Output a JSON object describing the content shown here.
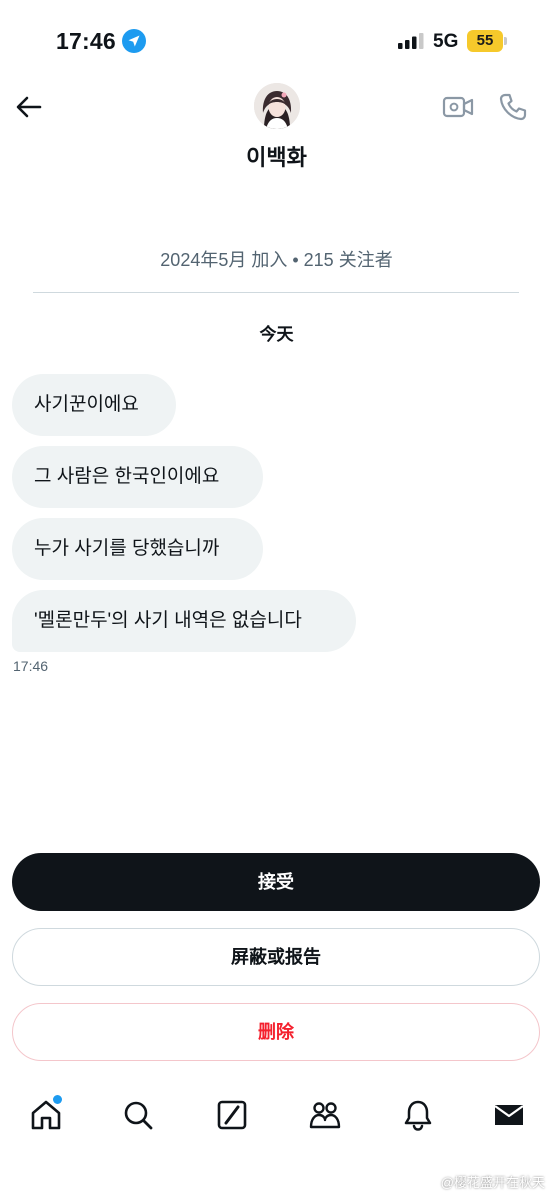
{
  "status_bar": {
    "time": "17:46",
    "network": "5G",
    "battery": "55",
    "icons": [
      "location-arrow-icon",
      "signal-bars-icon",
      "battery-icon"
    ]
  },
  "header": {
    "contact_name": "이백화",
    "icons": [
      "back-arrow-icon",
      "video-call-icon",
      "phone-icon"
    ]
  },
  "profile": {
    "meta": "2024年5月 加入 • 215 关注者"
  },
  "conversation": {
    "date_label": "今天",
    "messages": [
      {
        "text": "사기꾼이에요"
      },
      {
        "text": "그 사람은 한국인이에요"
      },
      {
        "text": "누가 사기를 당했습니까"
      },
      {
        "text": "'멜론만두'의 사기 내역은 없습니다"
      }
    ],
    "last_time": "17:46"
  },
  "actions": {
    "accept": "接受",
    "block_report": "屏蔽或报告",
    "delete": "删除"
  },
  "bottom_nav": {
    "items": [
      "home-icon",
      "search-icon",
      "grok-icon",
      "communities-icon",
      "notifications-icon",
      "messages-icon"
    ],
    "accent": "#1d9bf0"
  },
  "watermark": {
    "text": "@樱花盛开在秋天"
  },
  "colors": {
    "primary_text": "#0f1419",
    "secondary_text": "#536471",
    "bubble": "#eff3f4",
    "danger": "#f4212e",
    "battery": "#f6c92b"
  }
}
